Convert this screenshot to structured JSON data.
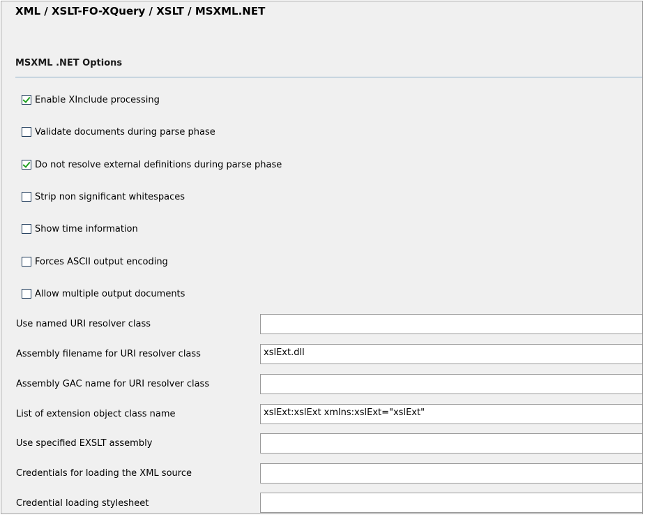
{
  "header": {
    "breadcrumb": "XML / XSLT-FO-XQuery / XSLT / MSXML.NET"
  },
  "section": {
    "title": "MSXML .NET Options"
  },
  "checkboxes": [
    {
      "label": "Enable XInclude processing",
      "checked": true
    },
    {
      "label": "Validate documents during parse phase",
      "checked": false
    },
    {
      "label": "Do not resolve external definitions during parse phase",
      "checked": true
    },
    {
      "label": "Strip non significant whitespaces",
      "checked": false
    },
    {
      "label": "Show time information",
      "checked": false
    },
    {
      "label": "Forces ASCII output encoding",
      "checked": false
    },
    {
      "label": "Allow multiple output documents",
      "checked": false
    }
  ],
  "fields": [
    {
      "label": "Use named URI resolver class",
      "value": ""
    },
    {
      "label": "Assembly filename for URI resolver class",
      "value": "xslExt.dll"
    },
    {
      "label": "Assembly GAC name for URI resolver class",
      "value": ""
    },
    {
      "label": "List of extension object class name",
      "value": "xslExt:xslExt xmlns:xslExt=\"xslExt\""
    },
    {
      "label": "Use specified EXSLT assembly",
      "value": ""
    },
    {
      "label": "Credentials for loading the XML source",
      "value": ""
    },
    {
      "label": "Credential loading stylesheet",
      "value": ""
    }
  ],
  "colors": {
    "panel_bg": "#f0f0f0",
    "checkmark": "#21a121",
    "section_rule": "#8fb0c8"
  }
}
